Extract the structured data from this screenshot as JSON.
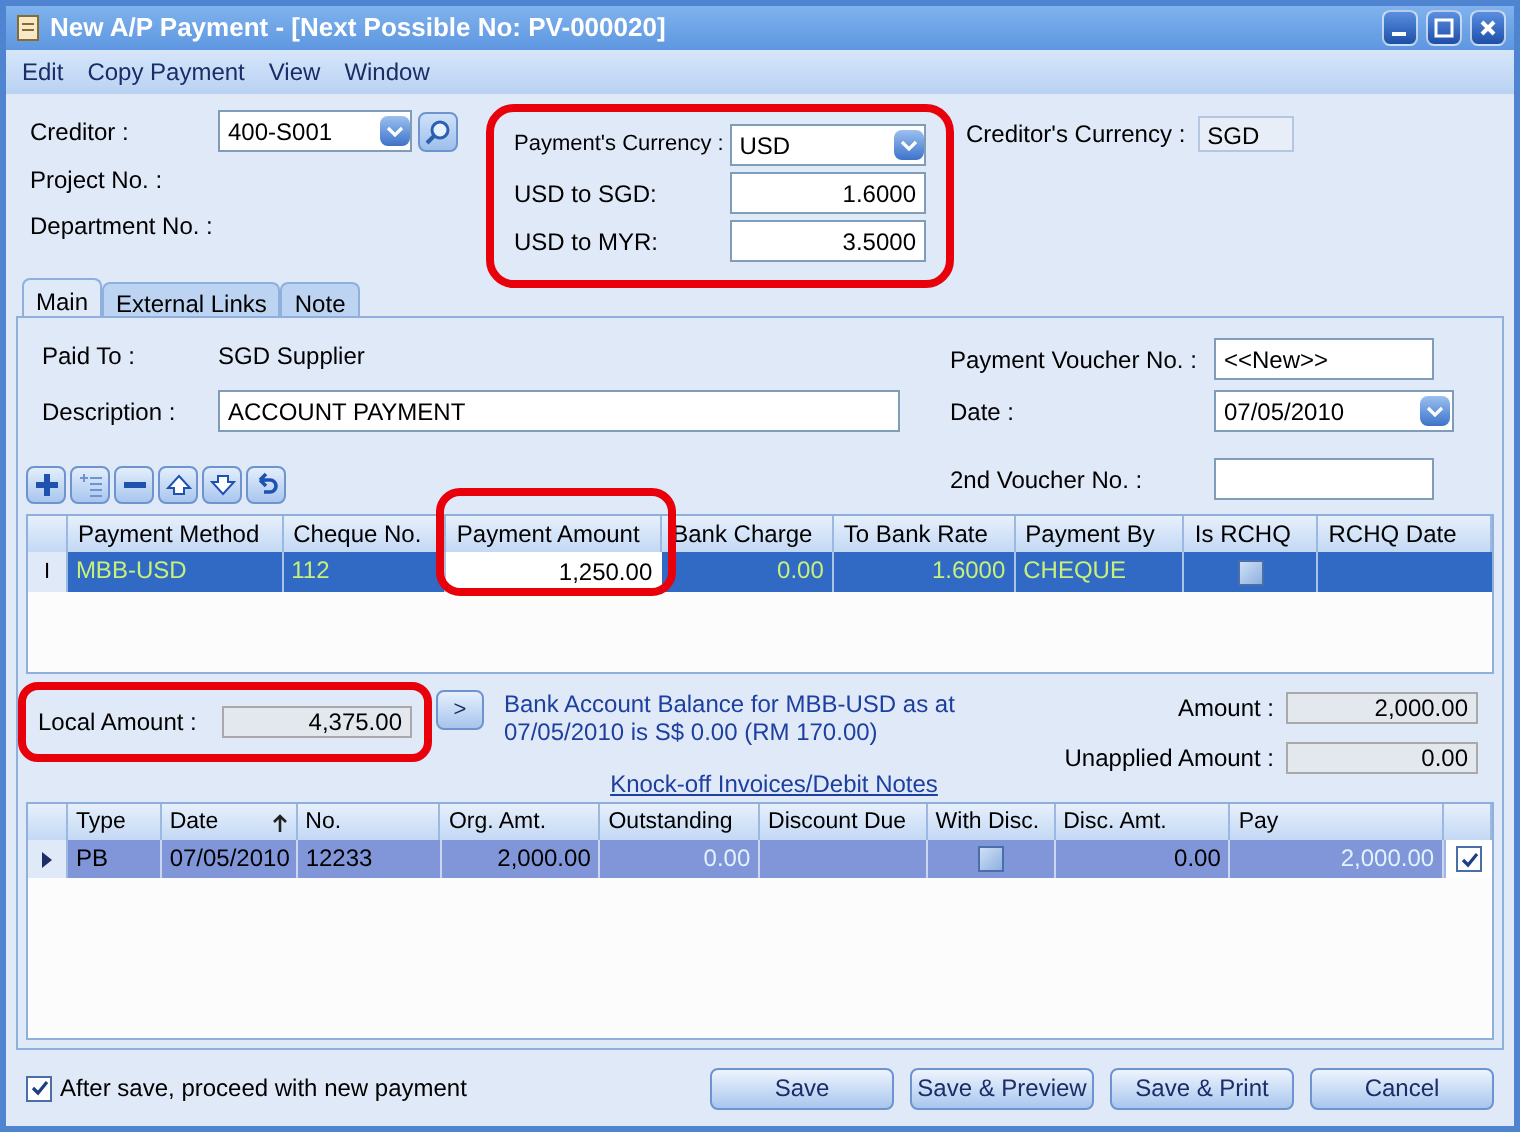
{
  "window": {
    "title": "New A/P Payment - [Next Possible No: PV-000020]"
  },
  "menu": [
    "Edit",
    "Copy Payment",
    "View",
    "Window"
  ],
  "header": {
    "creditor_label": "Creditor :",
    "creditor": "400-S001",
    "project_label": "Project No. :",
    "department_label": "Department No. :",
    "currency_group": {
      "highlighted": true,
      "currency_label": "Payment's Currency :",
      "currency": "USD",
      "rates": [
        {
          "label": "USD to SGD:",
          "value": "1.6000"
        },
        {
          "label": "USD to MYR:",
          "value": "3.5000"
        }
      ]
    },
    "creditor_currency_label": "Creditor's Currency :",
    "creditor_currency": "SGD"
  },
  "tabs": [
    {
      "label": "Main",
      "selected": true
    },
    {
      "label": "External Links",
      "selected": false
    },
    {
      "label": "Note",
      "selected": false
    }
  ],
  "main": {
    "paid_to_label": "Paid To :",
    "paid_to": "SGD Supplier",
    "description_label": "Description :",
    "description": "ACCOUNT PAYMENT",
    "voucher_label": "Payment Voucher No. :",
    "voucher": "<<New>>",
    "date_label": "Date :",
    "date": "07/05/2010",
    "second_voucher_label": "2nd Voucher No. :"
  },
  "payment_grid": {
    "columns": [
      {
        "name": "Payment Method",
        "highlighted": false
      },
      {
        "name": "Cheque No.",
        "highlighted": false
      },
      {
        "name": "Payment Amount",
        "highlighted": true
      },
      {
        "name": "Bank Charge",
        "highlighted": false
      },
      {
        "name": "To Bank Rate",
        "highlighted": false
      },
      {
        "name": "Payment By",
        "highlighted": false
      },
      {
        "name": "Is RCHQ",
        "highlighted": false
      },
      {
        "name": "RCHQ Date",
        "highlighted": false
      }
    ],
    "rows": [
      {
        "selected": true,
        "marker": "I",
        "cells": [
          {
            "kind": "text",
            "text": "MBB-USD",
            "focused": false
          },
          {
            "kind": "text",
            "text": "112",
            "focused": false
          },
          {
            "kind": "number",
            "text": "1,250.00",
            "focused": true
          },
          {
            "kind": "number",
            "text": "0.00",
            "focused": false
          },
          {
            "kind": "number",
            "text": "1.6000",
            "focused": false
          },
          {
            "kind": "text",
            "text": "CHEQUE",
            "focused": false
          },
          {
            "kind": "checkbox",
            "checked": false
          },
          {
            "kind": "empty"
          }
        ]
      }
    ]
  },
  "totals": {
    "local_amount_label": "Local Amount :",
    "local_amount": "4,375.00",
    "local_highlighted": true,
    "more_button": ">",
    "balance_note": "Bank Account Balance for MBB-USD as at 07/05/2010 is S$ 0.00 (RM 170.00)",
    "amount_label": "Amount :",
    "amount": "2,000.00",
    "unapplied_label": "Unapplied Amount :",
    "unapplied": "0.00"
  },
  "knockoff_link": "Knock-off Invoices/Debit Notes",
  "knockoff_grid": {
    "columns": [
      {
        "name": "Type",
        "sorted": false
      },
      {
        "name": "Date",
        "sorted": true
      },
      {
        "name": "No.",
        "sorted": false
      },
      {
        "name": "Org. Amt.",
        "sorted": false
      },
      {
        "name": "Outstanding",
        "sorted": false
      },
      {
        "name": "Discount Due",
        "sorted": false
      },
      {
        "name": "With Disc.",
        "sorted": false
      },
      {
        "name": "Disc. Amt.",
        "sorted": false
      },
      {
        "name": "Pay",
        "sorted": false
      }
    ],
    "rows": [
      {
        "selected": true,
        "checked": true,
        "cells": [
          {
            "kind": "text",
            "text": "PB",
            "editable": false
          },
          {
            "kind": "text",
            "text": "07/05/2010",
            "editable": false
          },
          {
            "kind": "text",
            "text": "12233",
            "editable": false
          },
          {
            "kind": "number",
            "text": "2,000.00",
            "editable": false
          },
          {
            "kind": "number",
            "text": "0.00",
            "editable": true
          },
          {
            "kind": "empty"
          },
          {
            "kind": "checkbox",
            "checked": false
          },
          {
            "kind": "number",
            "text": "0.00",
            "editable": false
          },
          {
            "kind": "number",
            "text": "2,000.00",
            "editable": true
          }
        ]
      }
    ]
  },
  "footer": {
    "proceed": {
      "label": "After save, proceed with new payment",
      "checked": true
    },
    "buttons": [
      "Save",
      "Save & Preview",
      "Save & Print",
      "Cancel"
    ]
  }
}
